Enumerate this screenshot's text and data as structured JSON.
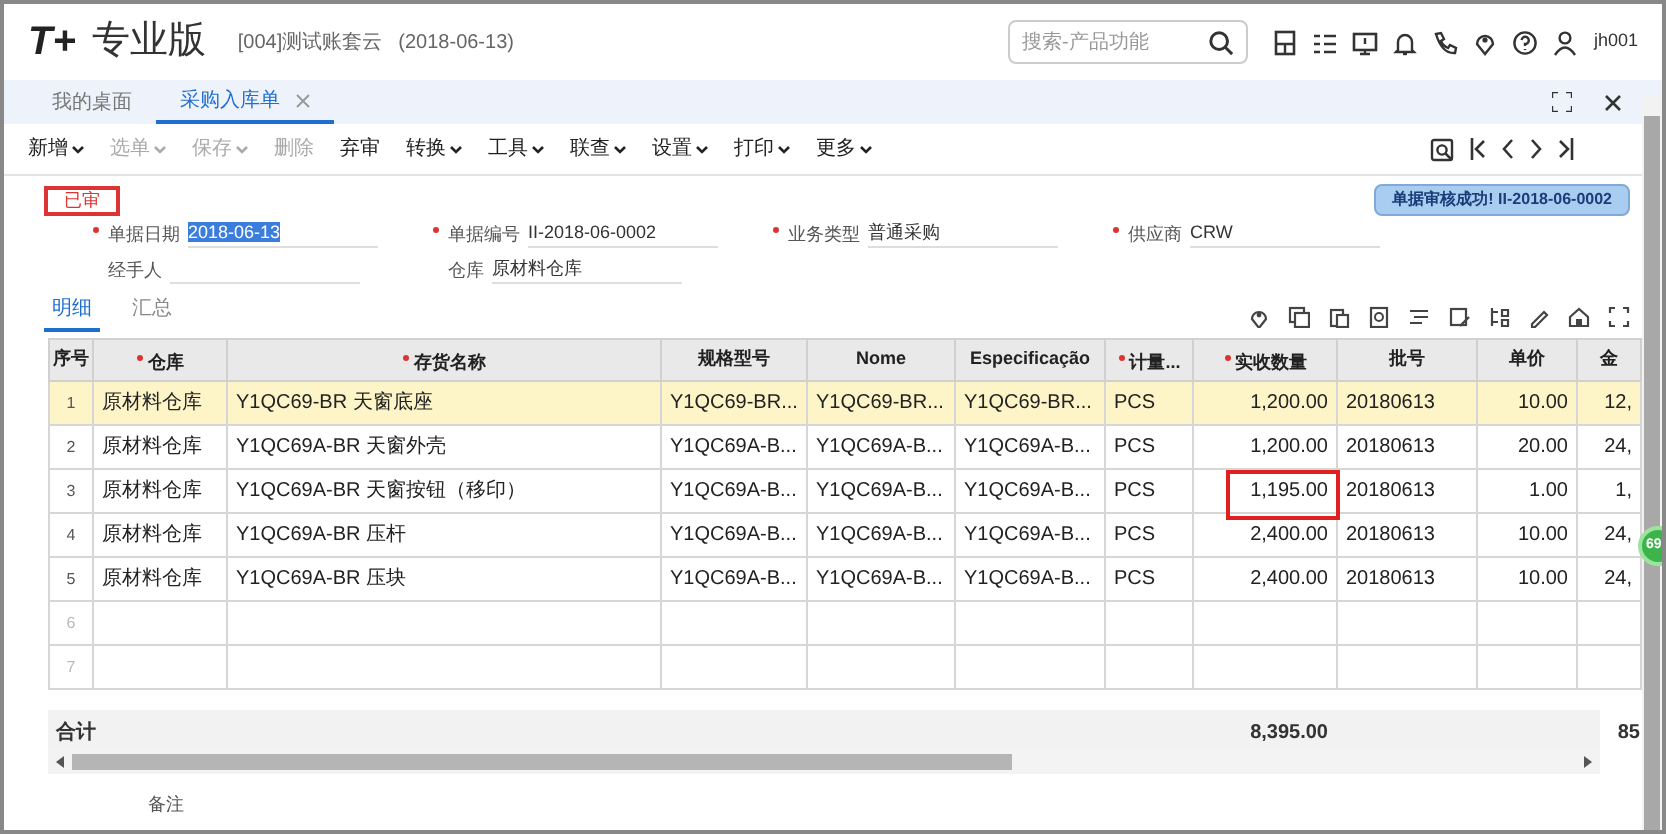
{
  "app": {
    "logo": "T+",
    "product": "专业版",
    "account": "[004]测试账套云",
    "date": "(2018-06-13)"
  },
  "search": {
    "placeholder": "搜索-产品功能"
  },
  "user": "jh001",
  "badge": "69",
  "tabs": [
    {
      "label": "我的桌面",
      "selected": false
    },
    {
      "label": "采购入库单",
      "selected": true
    }
  ],
  "toolbar": [
    {
      "label": "新增",
      "dropdown": true,
      "disabled": false
    },
    {
      "label": "选单",
      "dropdown": true,
      "disabled": true
    },
    {
      "label": "保存",
      "dropdown": true,
      "disabled": true
    },
    {
      "label": "删除",
      "dropdown": false,
      "disabled": true
    },
    {
      "label": "弃审",
      "dropdown": false,
      "disabled": false
    },
    {
      "label": "转换",
      "dropdown": true,
      "disabled": false
    },
    {
      "label": "工具",
      "dropdown": true,
      "disabled": false
    },
    {
      "label": "联查",
      "dropdown": true,
      "disabled": false
    },
    {
      "label": "设置",
      "dropdown": true,
      "disabled": false
    },
    {
      "label": "打印",
      "dropdown": true,
      "disabled": false
    },
    {
      "label": "更多",
      "dropdown": true,
      "disabled": false
    }
  ],
  "status_stamp": "已审",
  "notice": "单据审核成功! II-2018-06-0002",
  "fields": [
    {
      "label": "单据日期",
      "required": true,
      "value": "2018-06-13",
      "text_selected": true
    },
    {
      "label": "单据编号",
      "required": true,
      "value": "II-2018-06-0002",
      "text_selected": false
    },
    {
      "label": "业务类型",
      "required": true,
      "value": "普通采购",
      "text_selected": false
    },
    {
      "label": "供应商",
      "required": true,
      "value": "CRW",
      "text_selected": false
    },
    {
      "label": "经手人",
      "required": false
    },
    {
      "label": "仓库",
      "required": false,
      "value": "原材料仓库",
      "text_selected": false
    }
  ],
  "detail_tabs": [
    {
      "label": "明细",
      "selected": true
    },
    {
      "label": "汇总",
      "selected": false
    }
  ],
  "table": {
    "columns": [
      {
        "label": "序号",
        "required": false,
        "numeric": false
      },
      {
        "label": "仓库",
        "required": true,
        "numeric": false
      },
      {
        "label": "存货名称",
        "required": true,
        "numeric": false
      },
      {
        "label": "规格型号",
        "required": false,
        "numeric": false
      },
      {
        "label": "Nome",
        "required": false,
        "numeric": false
      },
      {
        "label": "Especificação",
        "required": false,
        "numeric": false
      },
      {
        "label": "计量...",
        "required": true,
        "numeric": false
      },
      {
        "label": "实收数量",
        "required": true,
        "numeric": true
      },
      {
        "label": "批号",
        "required": false,
        "numeric": false
      },
      {
        "label": "单价",
        "required": false,
        "numeric": true
      },
      {
        "label": "金",
        "required": false,
        "numeric": true
      }
    ],
    "rows": [
      {
        "selected": true,
        "qty_flagged": false,
        "cells": [
          "1",
          "原材料仓库",
          "Y1QC69-BR 天窗底座",
          "Y1QC69-BR...",
          "Y1QC69-BR...",
          "Y1QC69-BR...",
          "PCS",
          "1,200.00",
          "20180613",
          "10.00",
          "12,"
        ]
      },
      {
        "selected": false,
        "qty_flagged": false,
        "cells": [
          "2",
          "原材料仓库",
          "Y1QC69A-BR 天窗外壳",
          "Y1QC69A-B...",
          "Y1QC69A-B...",
          "Y1QC69A-B...",
          "PCS",
          "1,200.00",
          "20180613",
          "20.00",
          "24,"
        ]
      },
      {
        "selected": false,
        "qty_flagged": true,
        "cells": [
          "3",
          "原材料仓库",
          "Y1QC69A-BR 天窗按钮（移印）",
          "Y1QC69A-B...",
          "Y1QC69A-B...",
          "Y1QC69A-B...",
          "PCS",
          "1,195.00",
          "20180613",
          "1.00",
          "1,"
        ]
      },
      {
        "selected": false,
        "qty_flagged": false,
        "cells": [
          "4",
          "原材料仓库",
          "Y1QC69A-BR 压杆",
          "Y1QC69A-B...",
          "Y1QC69A-B...",
          "Y1QC69A-B...",
          "PCS",
          "2,400.00",
          "20180613",
          "10.00",
          "24,"
        ]
      },
      {
        "selected": false,
        "qty_flagged": false,
        "cells": [
          "5",
          "原材料仓库",
          "Y1QC69A-BR 压块",
          "Y1QC69A-B...",
          "Y1QC69A-B...",
          "Y1QC69A-B...",
          "PCS",
          "2,400.00",
          "20180613",
          "10.00",
          "24,"
        ]
      },
      {
        "selected": false,
        "qty_flagged": false,
        "cells": [
          "6"
        ]
      },
      {
        "selected": false,
        "qty_flagged": false,
        "cells": [
          "7"
        ]
      }
    ],
    "totals": {
      "label": "合计",
      "qty": "8,395.00",
      "amount": "85"
    }
  },
  "remarks_label": "备注"
}
